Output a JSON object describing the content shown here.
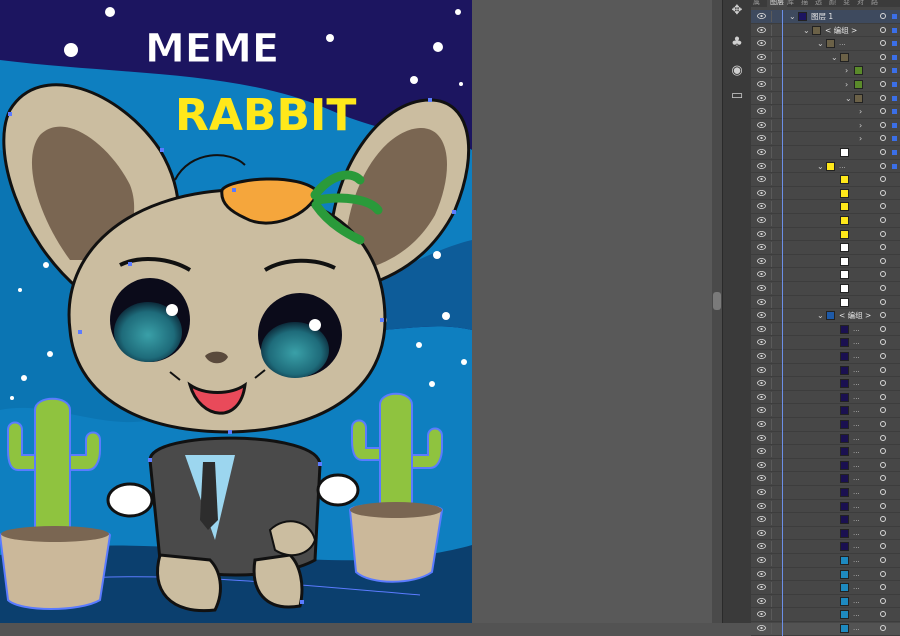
{
  "artwork": {
    "title_line1": "MEME",
    "title_line2": "RABBIT"
  },
  "layers_panel": {
    "tabs": [
      "属",
      "图层",
      "库",
      "描",
      "透",
      "颜",
      "变",
      "对",
      "路"
    ],
    "active_tab": 1,
    "top_layer_name": "图层 1",
    "group_label": "< 编组 >",
    "truncated_name": "...",
    "rows": [
      {
        "indent": 0,
        "arrow": "v",
        "thumb": "layer",
        "name": "top",
        "selected": true
      },
      {
        "indent": 1,
        "arrow": "v",
        "thumb": "art",
        "name": "group"
      },
      {
        "indent": 2,
        "arrow": "v",
        "thumb": "art",
        "name": "dots"
      },
      {
        "indent": 3,
        "arrow": "v",
        "thumb": "art",
        "name": ""
      },
      {
        "indent": 4,
        "arrow": ">",
        "thumb": "green",
        "name": ""
      },
      {
        "indent": 4,
        "arrow": ">",
        "thumb": "green",
        "name": ""
      },
      {
        "indent": 4,
        "arrow": "v",
        "thumb": "art",
        "name": ""
      },
      {
        "indent": 5,
        "arrow": ">",
        "thumb": "none",
        "name": ""
      },
      {
        "indent": 5,
        "arrow": ">",
        "thumb": "none",
        "name": ""
      },
      {
        "indent": 5,
        "arrow": ">",
        "thumb": "none",
        "name": ""
      },
      {
        "indent": 3,
        "arrow": "",
        "thumb": "white",
        "name": ""
      },
      {
        "indent": 2,
        "arrow": "v",
        "thumb": "yellow",
        "name": "dots"
      },
      {
        "indent": 3,
        "arrow": "",
        "thumb": "yellow",
        "name": ""
      },
      {
        "indent": 3,
        "arrow": "",
        "thumb": "yellow",
        "name": ""
      },
      {
        "indent": 3,
        "arrow": "",
        "thumb": "yellow",
        "name": ""
      },
      {
        "indent": 3,
        "arrow": "",
        "thumb": "yellow",
        "name": ""
      },
      {
        "indent": 3,
        "arrow": "",
        "thumb": "yellow",
        "name": ""
      },
      {
        "indent": 3,
        "arrow": "",
        "thumb": "white",
        "name": ""
      },
      {
        "indent": 3,
        "arrow": "",
        "thumb": "white",
        "name": ""
      },
      {
        "indent": 3,
        "arrow": "",
        "thumb": "white",
        "name": ""
      },
      {
        "indent": 3,
        "arrow": "",
        "thumb": "white",
        "name": ""
      },
      {
        "indent": 3,
        "arrow": "",
        "thumb": "white",
        "name": ""
      },
      {
        "indent": 2,
        "arrow": "v",
        "thumb": "blue",
        "name": "group"
      },
      {
        "indent": 3,
        "arrow": "",
        "thumb": "navy",
        "name": "dots"
      },
      {
        "indent": 3,
        "arrow": "",
        "thumb": "navy",
        "name": "dots"
      },
      {
        "indent": 3,
        "arrow": "",
        "thumb": "navy",
        "name": "dots"
      },
      {
        "indent": 3,
        "arrow": "",
        "thumb": "navy",
        "name": "dots"
      },
      {
        "indent": 3,
        "arrow": "",
        "thumb": "navy",
        "name": "dots"
      },
      {
        "indent": 3,
        "arrow": "",
        "thumb": "navy",
        "name": "dots"
      },
      {
        "indent": 3,
        "arrow": "",
        "thumb": "navy",
        "name": "dots"
      },
      {
        "indent": 3,
        "arrow": "",
        "thumb": "navy",
        "name": "dots"
      },
      {
        "indent": 3,
        "arrow": "",
        "thumb": "navy",
        "name": "dots"
      },
      {
        "indent": 3,
        "arrow": "",
        "thumb": "navy",
        "name": "dots"
      },
      {
        "indent": 3,
        "arrow": "",
        "thumb": "navy",
        "name": "dots"
      },
      {
        "indent": 3,
        "arrow": "",
        "thumb": "navy",
        "name": "dots"
      },
      {
        "indent": 3,
        "arrow": "",
        "thumb": "navy",
        "name": "dots"
      },
      {
        "indent": 3,
        "arrow": "",
        "thumb": "navy",
        "name": "dots"
      },
      {
        "indent": 3,
        "arrow": "",
        "thumb": "navy",
        "name": "dots"
      },
      {
        "indent": 3,
        "arrow": "",
        "thumb": "navy",
        "name": "dots"
      },
      {
        "indent": 3,
        "arrow": "",
        "thumb": "navy",
        "name": "dots"
      },
      {
        "indent": 3,
        "arrow": "",
        "thumb": "teal",
        "name": "dots"
      },
      {
        "indent": 3,
        "arrow": "",
        "thumb": "teal",
        "name": "dots"
      },
      {
        "indent": 3,
        "arrow": "",
        "thumb": "teal",
        "name": "dots"
      },
      {
        "indent": 3,
        "arrow": "",
        "thumb": "teal",
        "name": "dots"
      },
      {
        "indent": 3,
        "arrow": "",
        "thumb": "teal",
        "name": "dots"
      },
      {
        "indent": 3,
        "arrow": "",
        "thumb": "teal",
        "name": "dots"
      }
    ]
  },
  "tools": [
    "move-tool-icon",
    "club-symbol-icon",
    "globe-icon",
    "panel-icon"
  ],
  "colors": {
    "sky": "#1c1560",
    "wave": "#0e7fc0",
    "fur": "#cbbda0",
    "fur_dark": "#7a6652",
    "cactus": "#8fc33f",
    "pot": "#cbb89a",
    "selection": "#5b7bff",
    "title_white": "#ffffff",
    "title_yellow": "#ffe81a"
  }
}
